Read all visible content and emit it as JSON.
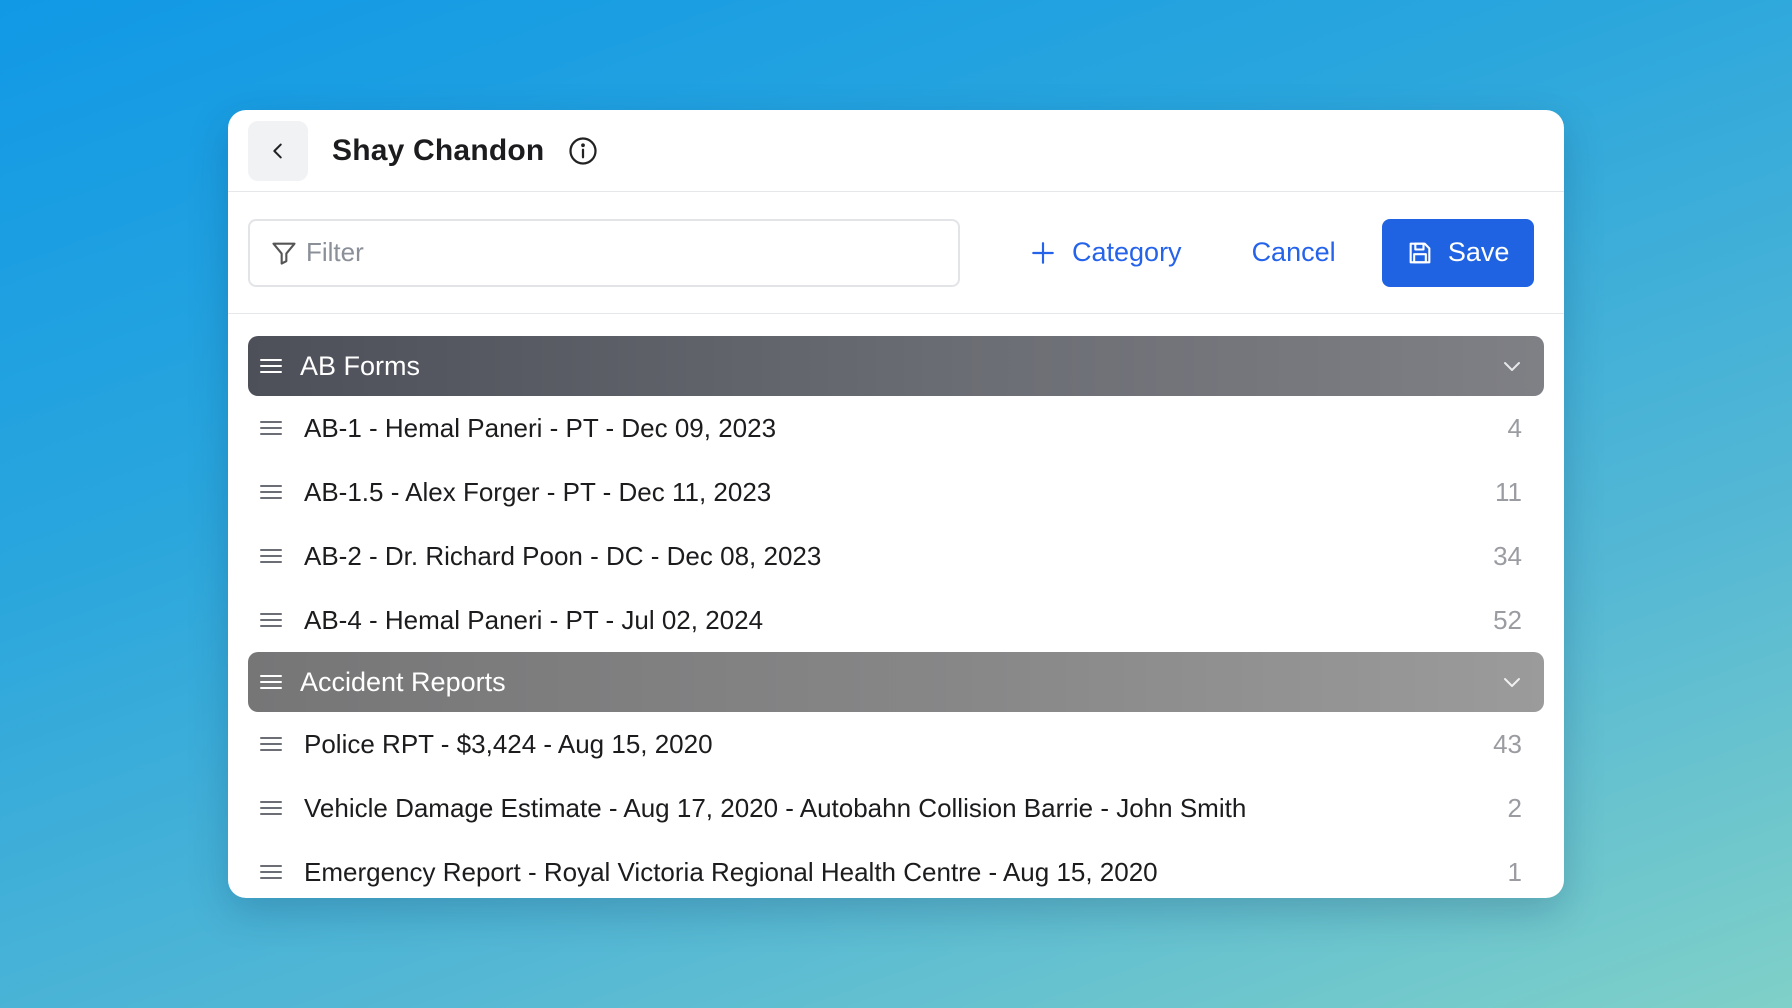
{
  "header": {
    "title": "Shay Chandon"
  },
  "toolbar": {
    "filter_placeholder": "Filter",
    "category_label": "Category",
    "cancel_label": "Cancel",
    "save_label": "Save"
  },
  "categories": [
    {
      "name": "AB Forms",
      "items": [
        {
          "label": "AB-1 - Hemal Paneri - PT - Dec 09, 2023",
          "count": "4"
        },
        {
          "label": "AB-1.5 - Alex Forger - PT - Dec 11, 2023",
          "count": "11"
        },
        {
          "label": "AB-2 - Dr. Richard Poon - DC - Dec 08, 2023",
          "count": "34"
        },
        {
          "label": "AB-4 - Hemal Paneri - PT - Jul 02, 2024",
          "count": "52"
        }
      ]
    },
    {
      "name": "Accident Reports",
      "items": [
        {
          "label": "Police RPT - $3,424 - Aug 15, 2020",
          "count": "43"
        },
        {
          "label": "Vehicle Damage Estimate - Aug 17, 2020 - Autobahn Collision Barrie - John Smith",
          "count": "2"
        },
        {
          "label": "Emergency Report - Royal Victoria Regional Health Centre - Aug 15, 2020",
          "count": "1"
        }
      ]
    }
  ]
}
